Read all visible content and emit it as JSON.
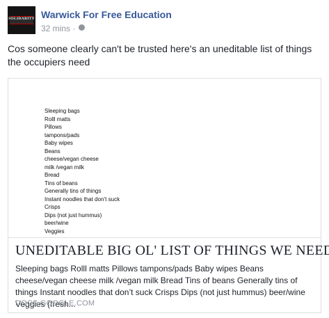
{
  "post": {
    "page_name": "Warwick For Free Education",
    "timestamp": "32 mins",
    "separator": "·",
    "audience_icon": "globe-icon",
    "avatar_text": "SOLIDARITY",
    "text": "Cos someone clearly can't be trusted here's an uneditable list of things the occupiers need"
  },
  "link_card": {
    "preview_list": [
      "Sleeping bags",
      "Rolll matts",
      "Pillows",
      "tampons/pads",
      "Baby wipes",
      "Beans",
      "cheese/vegan cheese",
      "milk /vegan milk",
      "Bread",
      "Tins of beans",
      "Generally tins of things",
      "Instant noodles that don’t suck",
      "Crisps",
      "Dips (not just hummus)",
      "beer/wine",
      "Veggies"
    ],
    "title": "UNEDITABLE BIG OL' LIST OF THINGS WE NEED",
    "description": "Sleeping bags Rolll matts Pillows tampons/pads Baby wipes Beans cheese/vegan cheese milk /vegan milk Bread Tins of beans Generally tins of things Instant noodles that don’t suck Crisps Dips (not just hummus) beer/wine Veggies (fresh...",
    "domain": "DOCS.GOOGLE.COM"
  },
  "colors": {
    "link_blue": "#365899",
    "meta_gray": "#90949c",
    "text": "#1d2129",
    "border": "#dddfe2"
  }
}
